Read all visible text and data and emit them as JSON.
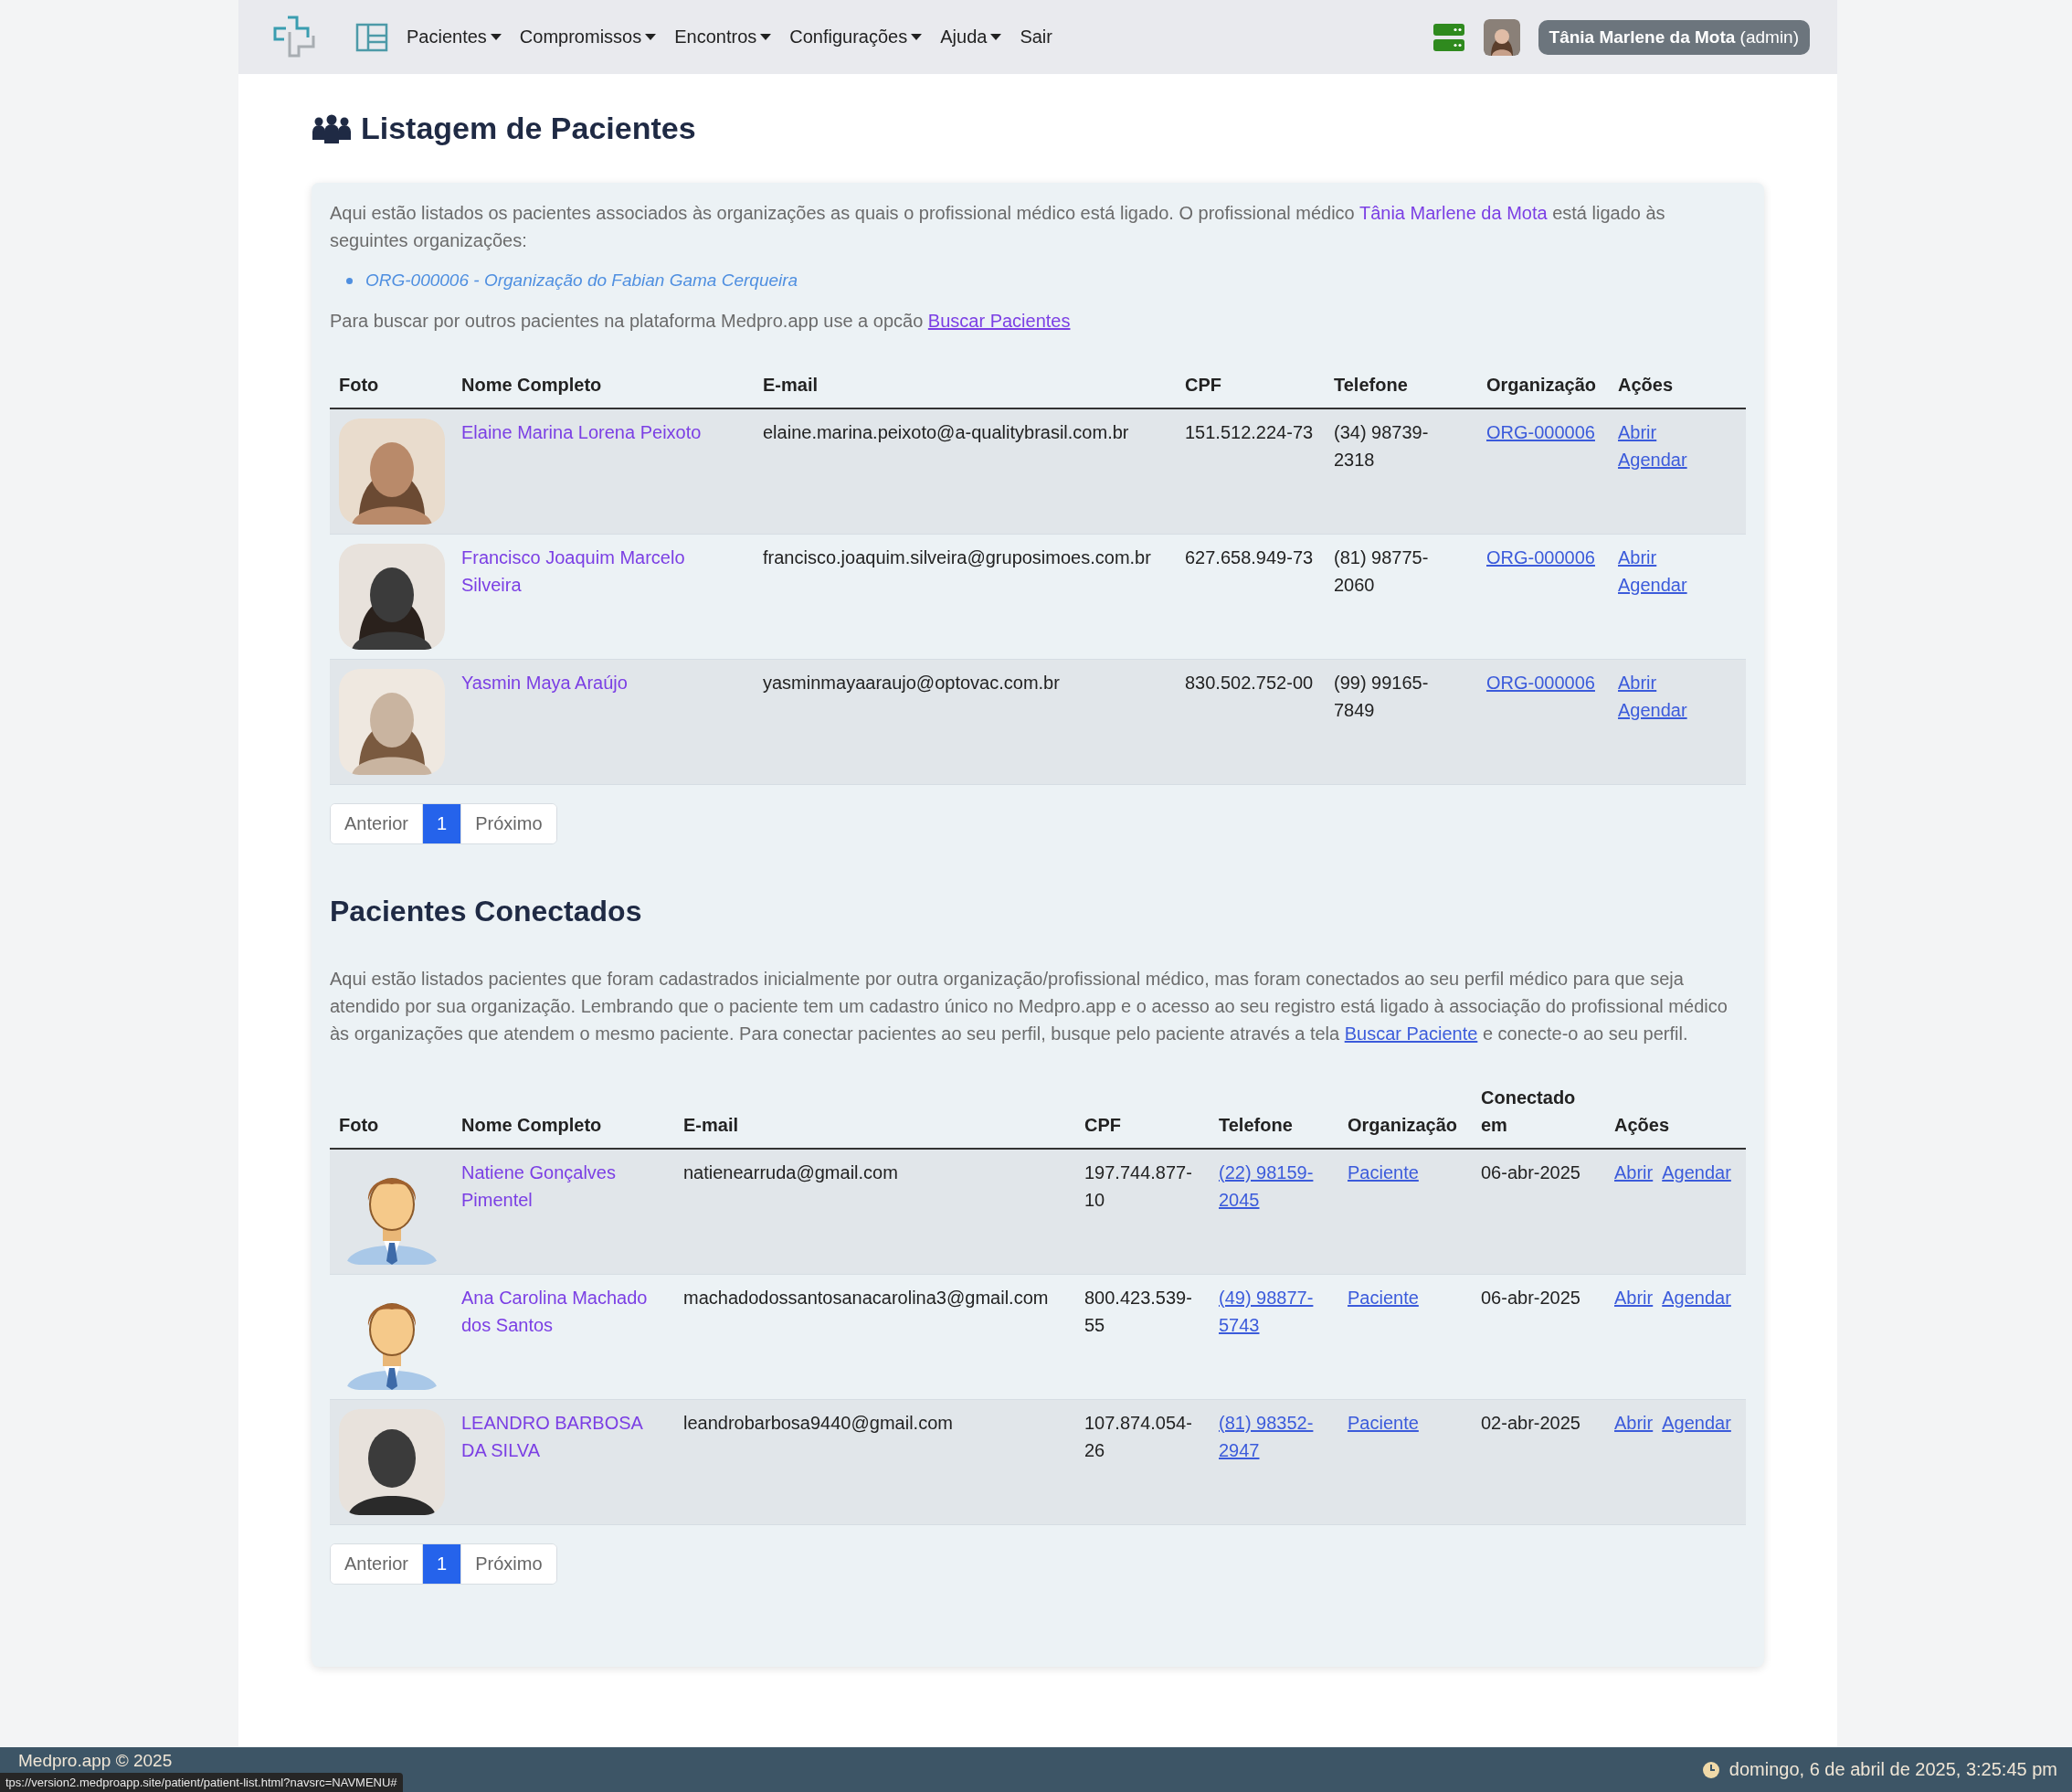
{
  "navbar": {
    "menu": [
      {
        "label": "Pacientes",
        "dropdown": true
      },
      {
        "label": "Compromissos",
        "dropdown": true
      },
      {
        "label": "Encontros",
        "dropdown": true
      },
      {
        "label": "Configurações",
        "dropdown": true
      },
      {
        "label": "Ajuda",
        "dropdown": true
      },
      {
        "label": "Sair",
        "dropdown": false
      }
    ],
    "user": {
      "name": "Tânia Marlene da Mota",
      "role": "(admin)"
    }
  },
  "page_title": "Listagem de Pacientes",
  "intro": {
    "before": "Aqui estão listados os pacientes associados às organizações as quais o profissional médico está ligado. O profissional médico",
    "doctor": "Tânia Marlene da Mota",
    "after": "está ligado às seguintes organizações:"
  },
  "organizations": [
    "ORG-000006 - Organização do Fabian Gama Cerqueira"
  ],
  "search_hint": {
    "text": "Para buscar por outros pacientes na plataforma Medpro.app use a opcão",
    "link": "Buscar Pacientes"
  },
  "patients_table": {
    "columns": [
      "Foto",
      "Nome Completo",
      "E-mail",
      "CPF",
      "Telefone",
      "Organização",
      "Ações"
    ],
    "rows": [
      {
        "photo": {
          "kind": "picture"
        },
        "name": "Elaine Marina Lorena Peixoto",
        "email": "elaine.marina.peixoto@a-qualitybrasil.com.br",
        "cpf": "151.512.224-73",
        "phone": "(34) 98739-2318",
        "organization": "ORG-000006",
        "actions": [
          "Abrir",
          "Agendar"
        ]
      },
      {
        "photo": {
          "kind": "picture"
        },
        "name": "Francisco Joaquim Marcelo Silveira",
        "email": "francisco.joaquim.silveira@gruposimoes.com.br",
        "cpf": "627.658.949-73",
        "phone": "(81) 98775-2060",
        "organization": "ORG-000006",
        "actions": [
          "Abrir",
          "Agendar"
        ]
      },
      {
        "photo": {
          "kind": "picture"
        },
        "name": "Yasmin Maya Araújo",
        "email": "yasminmayaaraujo@optovac.com.br",
        "cpf": "830.502.752-00",
        "phone": "(99) 99165-7849",
        "organization": "ORG-000006",
        "actions": [
          "Abrir",
          "Agendar"
        ]
      }
    ]
  },
  "patients_pagination": {
    "previous": "Anterior",
    "pages": [
      {
        "label": "1",
        "selected": true
      }
    ],
    "next": "Próximo"
  },
  "connected": {
    "title": "Pacientes Conectados",
    "description": {
      "text": "Aqui estão listados pacientes que foram cadastrados inicialmente por outra organização/profissional médico, mas foram conectados ao seu perfil médico para que seja atendido por sua organização. Lembrando que o paciente tem um cadastro único no Medpro.app e o acesso ao seu registro está ligado à associação do profissional médico às organizações que atendem o mesmo paciente. Para conectar pacientes ao seu perfil, busque pelo paciente através a tela",
      "link": "Buscar Paciente",
      "after": "e conecte-o ao seu perfil."
    },
    "columns": [
      "Foto",
      "Nome Completo",
      "E-mail",
      "CPF",
      "Telefone",
      "Organização",
      "Conectado em",
      "Ações"
    ],
    "rows": [
      {
        "photo": {
          "kind": "avatar"
        },
        "name": "Natiene Gonçalves Pimentel",
        "email": "natienearruda@gmail.com",
        "cpf": "197.744.877-10",
        "phone": "(22) 98159-2045",
        "organization": "Paciente",
        "connected_at": "06-abr-2025",
        "actions": [
          "Abrir",
          "Agendar"
        ]
      },
      {
        "photo": {
          "kind": "avatar"
        },
        "name": "Ana Carolina Machado dos Santos",
        "email": "machadodossantosanacarolina3@gmail.com",
        "cpf": "800.423.539-55",
        "phone": "(49) 98877-5743",
        "organization": "Paciente",
        "connected_at": "06-abr-2025",
        "actions": [
          "Abrir",
          "Agendar"
        ]
      },
      {
        "photo": {
          "kind": "picture"
        },
        "name": "LEANDRO BARBOSA DA SILVA",
        "email": "leandrobarbosa9440@gmail.com",
        "cpf": "107.874.054-26",
        "phone": "(81) 98352-2947",
        "organization": "Paciente",
        "connected_at": "02-abr-2025",
        "actions": [
          "Abrir",
          "Agendar"
        ]
      }
    ],
    "pagination": {
      "previous": "Anterior",
      "pages": [
        {
          "label": "1",
          "selected": true
        }
      ],
      "next": "Próximo"
    }
  },
  "footer": {
    "copyright": "Medpro.app © 2025",
    "datetime": "domingo, 6 de abril de 2025, 3:25:45 pm"
  },
  "status_url": "tps://version2.medproapp.site/patient/patient-list.html?navsrc=NAVMENU#"
}
